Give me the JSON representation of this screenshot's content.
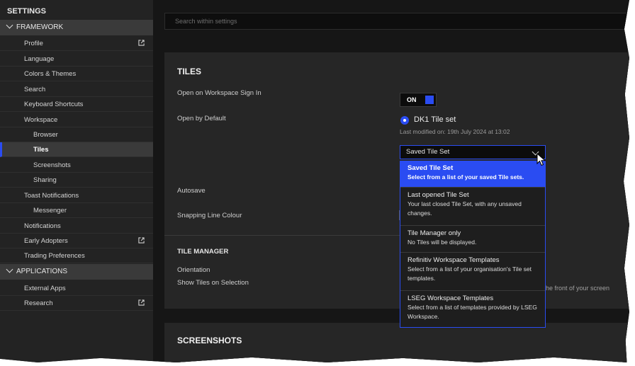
{
  "sidebar": {
    "title": "SETTINGS",
    "sections": {
      "framework": "FRAMEWORK",
      "applications": "APPLICATIONS"
    },
    "items": {
      "profile": "Profile",
      "language": "Language",
      "colors": "Colors & Themes",
      "search": "Search",
      "shortcuts": "Keyboard Shortcuts",
      "workspace": "Workspace",
      "browser": "Browser",
      "tiles": "Tiles",
      "screenshots": "Screenshots",
      "sharing": "Sharing",
      "toast": "Toast Notifications",
      "messenger": "Messenger",
      "notifications": "Notifications",
      "early": "Early Adopters",
      "trading": "Trading Preferences",
      "external": "External Apps",
      "research": "Research"
    }
  },
  "search": {
    "placeholder": "Search within settings"
  },
  "tiles": {
    "heading": "TILES",
    "open_sign_in_label": "Open on Workspace Sign In",
    "toggle_value": "ON",
    "open_default_label": "Open by Default",
    "radio_label": "DK1 Tile set",
    "last_modified": "Last modified on: 19th July 2024 at 13:02",
    "select_value": "Saved Tile Set",
    "autosave_label": "Autosave",
    "snapping_label": "Snapping Line Colour",
    "dropdown": [
      {
        "title": "Saved Tile Set",
        "desc": "Select from a list of your saved Tile sets."
      },
      {
        "title": "Last opened Tile Set",
        "desc": "Your last closed Tile Set, with any unsaved changes."
      },
      {
        "title": "Tile Manager only",
        "desc": "No Tiles will be displayed."
      },
      {
        "title": "Refinitiv Workspace Templates",
        "desc": "Select from a list of your organisation's Tile set templates."
      },
      {
        "title": "LSEG Workspace Templates",
        "desc": "Select from a list of templates provided by LSEG Workspace."
      }
    ]
  },
  "tile_manager": {
    "heading": "TILE MANAGER",
    "orientation_label": "Orientation",
    "show_tiles_label": "Show Tiles on Selection",
    "partial_text": "he front of your screen"
  },
  "screenshots": {
    "heading": "SCREENSHOTS"
  },
  "colors": {
    "accent": "#2a4cf2",
    "background": "#1a1a1a"
  }
}
